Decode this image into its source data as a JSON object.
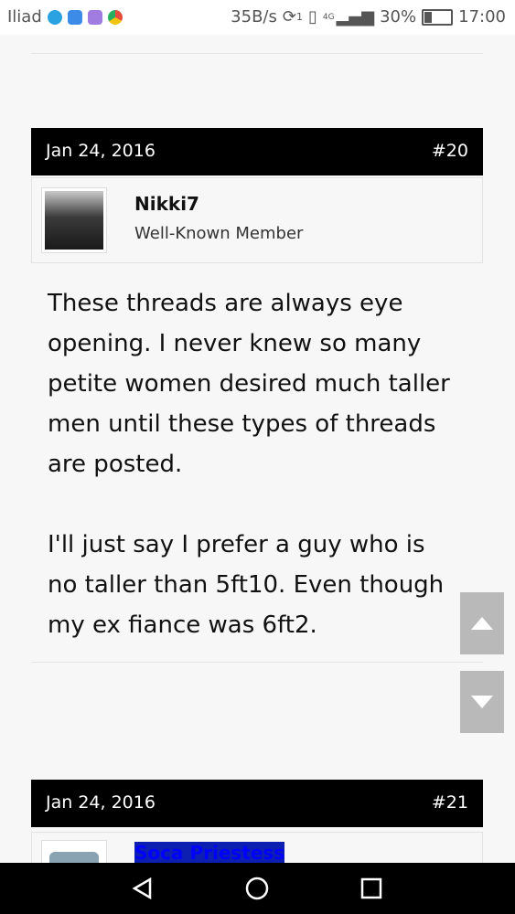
{
  "status_bar": {
    "carrier": "Iliad",
    "speed": "35B/s",
    "sync_badge": "1",
    "network": "4G",
    "battery": "30%",
    "time": "17:00"
  },
  "posts": [
    {
      "date": "Jan 24, 2016",
      "number": "#20",
      "user": {
        "name": "Nikki7",
        "title": "Well-Known Member"
      },
      "paragraphs": [
        "These threads are always eye opening. I never knew so many petite women desired much taller men until these types of threads are posted.",
        "I'll just say I prefer a guy who is no taller than 5ft10. Even though my ex fiance was 6ft2."
      ]
    },
    {
      "date": "Jan 24, 2016",
      "number": "#21",
      "user": {
        "name": "Soca Priestess"
      }
    }
  ],
  "colors": {
    "header_bg": "#000000",
    "scroll_btn": "#b9b9b9",
    "username2": "#0000ff"
  },
  "icons": {
    "scroll_up": "triangle-up-icon",
    "scroll_down": "triangle-down-icon",
    "nav_back": "back-triangle-icon",
    "nav_home": "circle-home-icon",
    "nav_recents": "square-recents-icon"
  }
}
